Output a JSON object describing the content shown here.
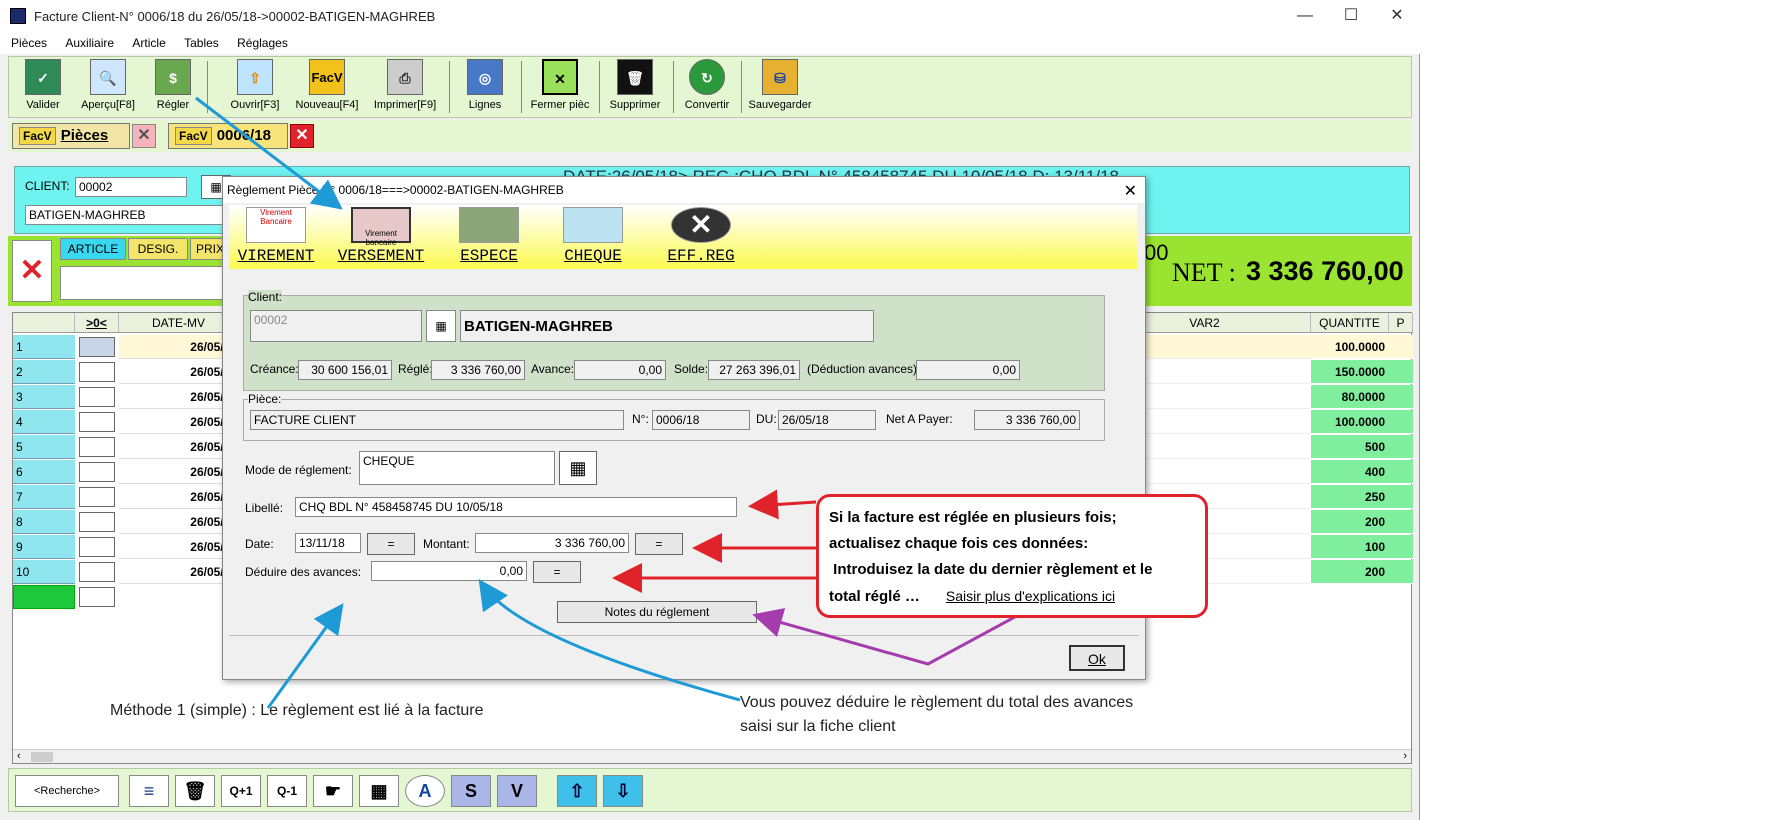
{
  "window": {
    "title": "Facture Client-N° 0006/18 du 26/05/18->00002-BATIGEN-MAGHREB",
    "minimize": "—",
    "maximize": "☐",
    "close": "✕"
  },
  "menu": [
    "Pièces",
    "Auxiliaire",
    "Article",
    "Tables",
    "Réglages"
  ],
  "toolbar": [
    {
      "label": "Valider",
      "icon": "validate-icon"
    },
    {
      "label": "Aperçu[F8]",
      "icon": "preview-icon"
    },
    {
      "label": "Régler",
      "icon": "money-icon"
    },
    {
      "label": "Ouvrir[F3]",
      "icon": "open-icon"
    },
    {
      "label": "Nouveau[F4]",
      "icon": "new-invoice-icon",
      "text": "FacV"
    },
    {
      "label": "Imprimer[F9]",
      "icon": "printer-icon"
    },
    {
      "label": "Lignes",
      "icon": "lines-icon"
    },
    {
      "label": "Fermer pièc",
      "icon": "close-piece-icon"
    },
    {
      "label": "Supprimer",
      "icon": "trash-icon"
    },
    {
      "label": "Convertir",
      "icon": "convert-icon"
    },
    {
      "label": "Sauvegarder",
      "icon": "save-icon"
    }
  ],
  "tabs": {
    "pieces": {
      "tag": "FacV",
      "label": "Pièces"
    },
    "invoice": {
      "tag": "FacV",
      "label": "0006/18"
    }
  },
  "client_panel": {
    "label": "CLIENT:",
    "code": "00002",
    "name": "BATIGEN-MAGHREB",
    "date_banner": "DATE:26/05/18> REG.:CHQ BDL N° 458458745 DU 10/05/18 D: 13/11/18"
  },
  "green_bar": {
    "tabs": [
      "ARTICLE",
      "DESIG.",
      "PRIX"
    ],
    "net_label": "NET :",
    "net_value": "3 336 760,00",
    "partial": "00"
  },
  "grid": {
    "headers": {
      "check": ">0<",
      "date": "DATE-MV",
      "var2": "VAR2",
      "qty": "QUANTITE",
      "p": "P"
    },
    "rows": [
      {
        "n": "1",
        "date": "26/05/18",
        "qty": "100.0000"
      },
      {
        "n": "2",
        "date": "26/05/18",
        "qty": "150.0000"
      },
      {
        "n": "3",
        "date": "26/05/18",
        "qty": "80.0000"
      },
      {
        "n": "4",
        "date": "26/05/18",
        "qty": "100.0000"
      },
      {
        "n": "5",
        "date": "26/05/18",
        "qty": "500"
      },
      {
        "n": "6",
        "date": "26/05/18",
        "qty": "400"
      },
      {
        "n": "7",
        "date": "26/05/18",
        "qty": "250"
      },
      {
        "n": "8",
        "date": "26/05/18",
        "qty": "200"
      },
      {
        "n": "9",
        "date": "26/05/18",
        "qty": "100"
      },
      {
        "n": "10",
        "date": "26/05/18",
        "qty": "200"
      }
    ]
  },
  "bottom_bar": {
    "search": "<Recherche>",
    "buttons": [
      "≡",
      "🗑",
      "Q+1",
      "Q-1",
      "☛",
      "▦",
      "A",
      "S",
      "V",
      "⇧",
      "⇩"
    ]
  },
  "dialog": {
    "title": "Règlement Pièce N° 0006/18===>00002-BATIGEN-MAGHREB",
    "close": "✕",
    "tools": [
      {
        "label": "VIREMENT",
        "icon": "bank-transfer-icon",
        "caption": "Virement Bancaire"
      },
      {
        "label": "VERSEMENT",
        "icon": "deposit-icon",
        "caption": "Virement bancaire"
      },
      {
        "label": "ESPECE",
        "icon": "cash-icon"
      },
      {
        "label": "CHEQUE",
        "icon": "cheque-icon"
      },
      {
        "label": "EFF.REG",
        "icon": "delete-icon"
      }
    ],
    "client": {
      "group": "Client:",
      "code": "00002",
      "name": "BATIGEN-MAGHREB",
      "creance_label": "Créance:",
      "creance": "30 600 156,01",
      "regle_label": "Réglé:",
      "regle": "3 336 760,00",
      "avance_label": "Avance:",
      "avance": "0,00",
      "solde_label": "Solde:",
      "solde": "27 263 396,01",
      "deduction_label": "(Déduction avances):",
      "deduction": "0,00"
    },
    "piece": {
      "group": "Pièce:",
      "type": "FACTURE CLIENT",
      "num_label": "N°:",
      "num": "0006/18",
      "du_label": "DU:",
      "du": "26/05/18",
      "net_label": "Net A Payer:",
      "net": "3 336 760,00"
    },
    "mode_label": "Mode de réglement:",
    "mode": "CHEQUE",
    "libelle_label": "Libellé:",
    "libelle": "CHQ BDL N° 458458745 DU 10/05/18",
    "date_label": "Date:",
    "date": "13/11/18",
    "eq": "=",
    "montant_label": "Montant:",
    "montant": "3 336 760,00",
    "deduire_label": "Déduire des avances:",
    "deduire": "0,00",
    "notes": "Notes du réglement",
    "ok": "Ok"
  },
  "annotations": {
    "callout_l1": "Si la facture est réglée en plusieurs fois;",
    "callout_l2": "actualisez chaque fois ces données:",
    "callout_l3": " Introduisez la date du dernier règlement et le",
    "callout_l4": "total réglé …",
    "callout_link": "Saisir plus d'explications ici",
    "method": "Méthode 1 (simple) : Le règlement est lié à la facture",
    "deduct_l1": "Vous pouvez déduire le règlement du total des avances",
    "deduct_l2": "saisi sur la fiche client"
  },
  "colors": {
    "accent_red": "#e0232b",
    "arrow_blue": "#1e9ad6",
    "arrow_purple": "#a43cae"
  }
}
